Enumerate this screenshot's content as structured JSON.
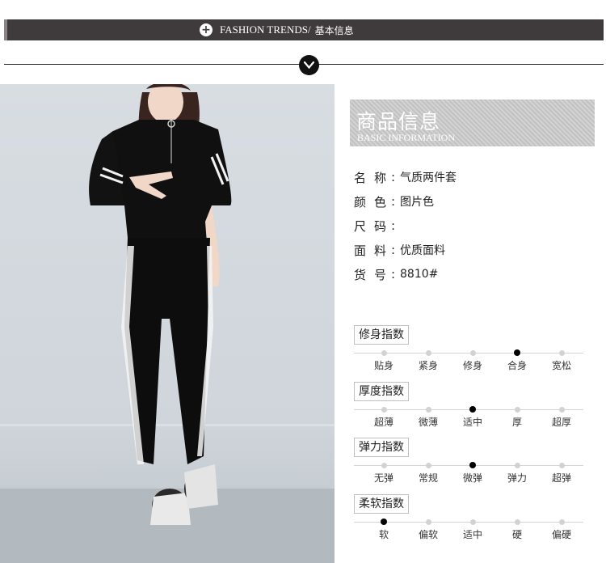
{
  "banner": {
    "title_en": "FASHION TRENDS/",
    "title_cn": "基本信息"
  },
  "panel": {
    "title_cn": "商品信息",
    "title_en": "BASIC INFORMATION"
  },
  "info": [
    {
      "key": "名称",
      "value": "气质两件套"
    },
    {
      "key": "颜色",
      "value": "图片色"
    },
    {
      "key": "尺码",
      "value": ""
    },
    {
      "key": "面料",
      "value": "优质面料"
    },
    {
      "key": "货号",
      "value": "8810#"
    }
  ],
  "info_colon": ":",
  "indices": [
    {
      "title": "修身指数",
      "options": [
        "贴身",
        "紧身",
        "修身",
        "合身",
        "宽松"
      ],
      "selected": "合身"
    },
    {
      "title": "厚度指数",
      "options": [
        "超薄",
        "微薄",
        "适中",
        "厚",
        "超厚"
      ],
      "selected": "适中"
    },
    {
      "title": "弹力指数",
      "options": [
        "无弹",
        "常规",
        "微弹",
        "弹力",
        "超弹"
      ],
      "selected": "微弹"
    },
    {
      "title": "柔软指数",
      "options": [
        "软",
        "偏软",
        "适中",
        "硬",
        "偏硬"
      ],
      "selected": "软"
    }
  ],
  "colors": {
    "banner_bg": "#3f3a3c",
    "dot_active": "#000000",
    "dot_inactive": "#d2d2d2"
  }
}
